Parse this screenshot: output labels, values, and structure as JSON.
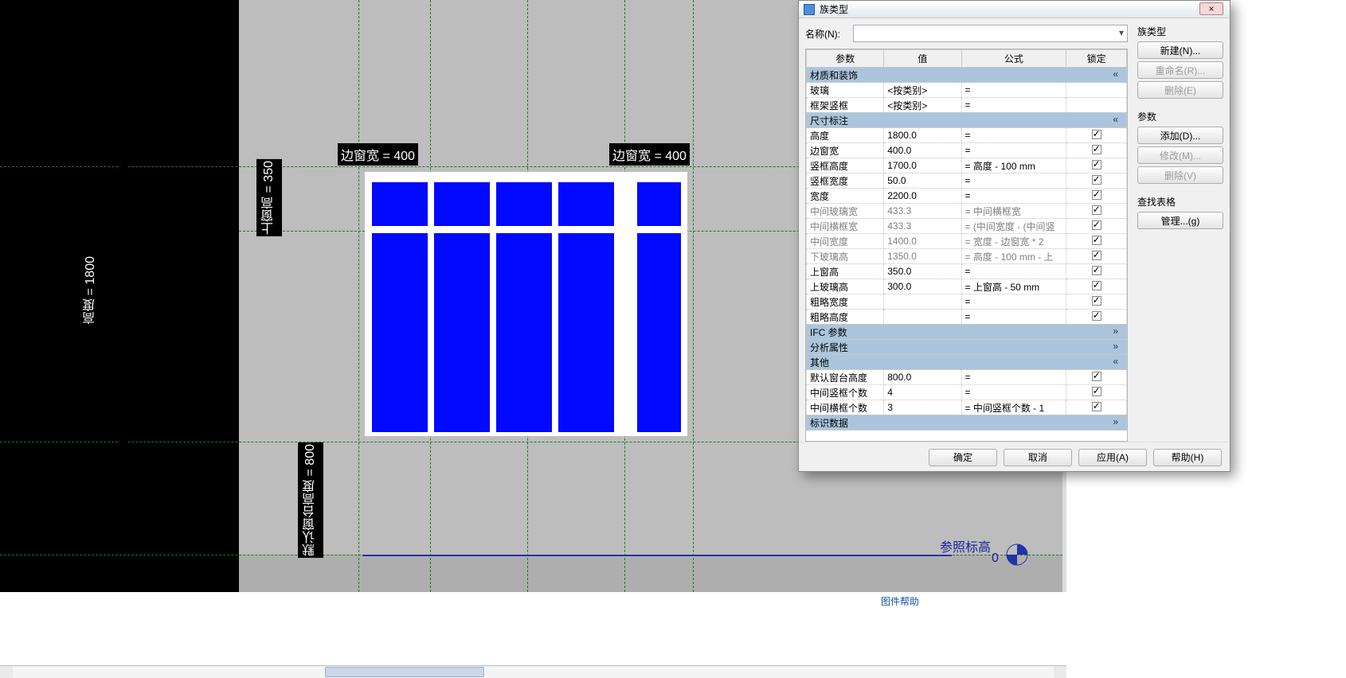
{
  "dialog": {
    "title": "族类型",
    "close_label": "×",
    "name_label": "名称(N):",
    "name_value": "",
    "columns": {
      "param": "参数",
      "value": "值",
      "formula": "公式",
      "lock": "锁定"
    },
    "cat_material": "材质和装饰",
    "cat_dim": "尺寸标注",
    "cat_ifc": "IFC 参数",
    "cat_analysis": "分析属性",
    "cat_other": "其他",
    "cat_iddata": "标识数据",
    "rows_material": [
      {
        "p": "玻璃",
        "v": "<按类别>",
        "f": "=",
        "lock": false
      },
      {
        "p": "框架竖框",
        "v": "<按类别>",
        "f": "=",
        "lock": false
      }
    ],
    "rows_dim": [
      {
        "p": "高度",
        "v": "1800.0",
        "f": "=",
        "lock": true
      },
      {
        "p": "边窗宽",
        "v": "400.0",
        "f": "=",
        "lock": true
      },
      {
        "p": "竖框高度",
        "v": "1700.0",
        "f": "= 高度 - 100 mm",
        "lock": true
      },
      {
        "p": "竖框宽度",
        "v": "50.0",
        "f": "=",
        "lock": true
      },
      {
        "p": "宽度",
        "v": "2200.0",
        "f": "=",
        "lock": true
      },
      {
        "p": "中间玻璃宽",
        "v": "433.3",
        "f": "= 中间横框宽",
        "lock": true,
        "ro": true
      },
      {
        "p": "中间横框宽",
        "v": "433.3",
        "f": "= (中间宽度 - (中间竖",
        "lock": true,
        "ro": true
      },
      {
        "p": "中间宽度",
        "v": "1400.0",
        "f": "= 宽度 - 边窗宽 * 2",
        "lock": true,
        "ro": true
      },
      {
        "p": "下玻璃高",
        "v": "1350.0",
        "f": "= 高度 - 100 mm - 上",
        "lock": true,
        "ro": true
      },
      {
        "p": "上窗高",
        "v": "350.0",
        "f": "=",
        "lock": true
      },
      {
        "p": "上玻璃高",
        "v": "300.0",
        "f": "= 上窗高 - 50 mm",
        "lock": true
      },
      {
        "p": "粗略宽度",
        "v": "",
        "f": "=",
        "lock": true
      },
      {
        "p": "粗略高度",
        "v": "",
        "f": "=",
        "lock": true
      }
    ],
    "rows_other": [
      {
        "p": "默认窗台高度",
        "v": "800.0",
        "f": "=",
        "lock": true
      },
      {
        "p": "中间竖框个数",
        "v": "4",
        "f": "=",
        "lock": true
      },
      {
        "p": "中间横框个数",
        "v": "3",
        "f": "= 中间竖框个数 - 1",
        "lock": true
      }
    ],
    "side": {
      "group_type": "族类型",
      "btn_new": "新建(N)...",
      "btn_rename": "重命名(R)...",
      "btn_delete": "删除(E)",
      "group_param": "参数",
      "btn_add": "添加(D)...",
      "btn_modify": "修改(M)...",
      "btn_del2": "删除(V)",
      "group_lookup": "查找表格",
      "btn_manage": "管理...(g)"
    },
    "foot": {
      "ok": "确定",
      "cancel": "取消",
      "apply": "应用(A)",
      "help": "帮助(H)"
    }
  },
  "annot": {
    "height": "高度 = 1800",
    "side_l": "边窗宽 = 400",
    "side_r": "边窗宽 = 400",
    "top": "上窗高 = 350",
    "sill": "默认窗台高度 = 800",
    "datum": "参照标高",
    "datum_val": "0"
  },
  "status": {
    "help": "图件帮助"
  }
}
